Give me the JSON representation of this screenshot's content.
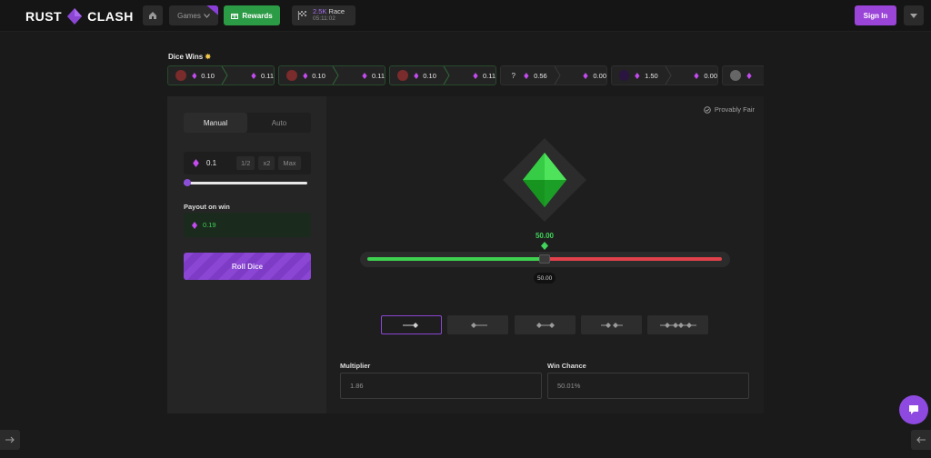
{
  "brand": {
    "left": "RUST",
    "right": "CLASH"
  },
  "header": {
    "games_label": "Games",
    "rewards_label": "Rewards",
    "race_amount": "2.5K",
    "race_label": "Race",
    "race_timer": "05:11:02",
    "signin_label": "Sign In"
  },
  "wins": {
    "title": "Dice Wins",
    "cards": [
      {
        "bet": "0.10",
        "payout": "0.11",
        "avatar": "red-hair-avatar",
        "status": "win"
      },
      {
        "bet": "0.10",
        "payout": "0.11",
        "avatar": "red-hair-avatar",
        "status": "win"
      },
      {
        "bet": "0.10",
        "payout": "0.11",
        "avatar": "red-hair-avatar",
        "status": "win"
      },
      {
        "bet": "0.56",
        "payout": "0.00",
        "avatar": "?",
        "status": "loss"
      },
      {
        "bet": "1.50",
        "payout": "0.00",
        "avatar": "dark-purple-avatar",
        "status": "loss"
      },
      {
        "bet": "",
        "payout": "",
        "avatar": "gray-avatar",
        "status": "partial"
      }
    ]
  },
  "controls": {
    "tab_manual": "Manual",
    "tab_auto": "Auto",
    "bet_amount": "0.1",
    "half_label": "1/2",
    "double_label": "x2",
    "max_label": "Max",
    "bet_slider_level": 0.0,
    "payout_label": "Payout on win",
    "payout_value": "0.19",
    "roll_label": "Roll Dice"
  },
  "game": {
    "provably_fair": "Provably Fair",
    "target_value": "50.00",
    "handle_value": "50.00",
    "roll_over_fraction": 0.5,
    "multiplier_label": "Multiplier",
    "multiplier_value": "1.86",
    "win_chance_label": "Win Chance",
    "win_chance_value": "50.01%",
    "modes": [
      "roll-under",
      "roll-over",
      "roll-between",
      "roll-outside",
      "roll-double-range"
    ],
    "active_mode": "roll-under"
  },
  "colors": {
    "accent": "#8b46d4",
    "win_green": "#3ed14f",
    "lose_red": "#e0414a",
    "rewards_green": "#2c9b45"
  }
}
